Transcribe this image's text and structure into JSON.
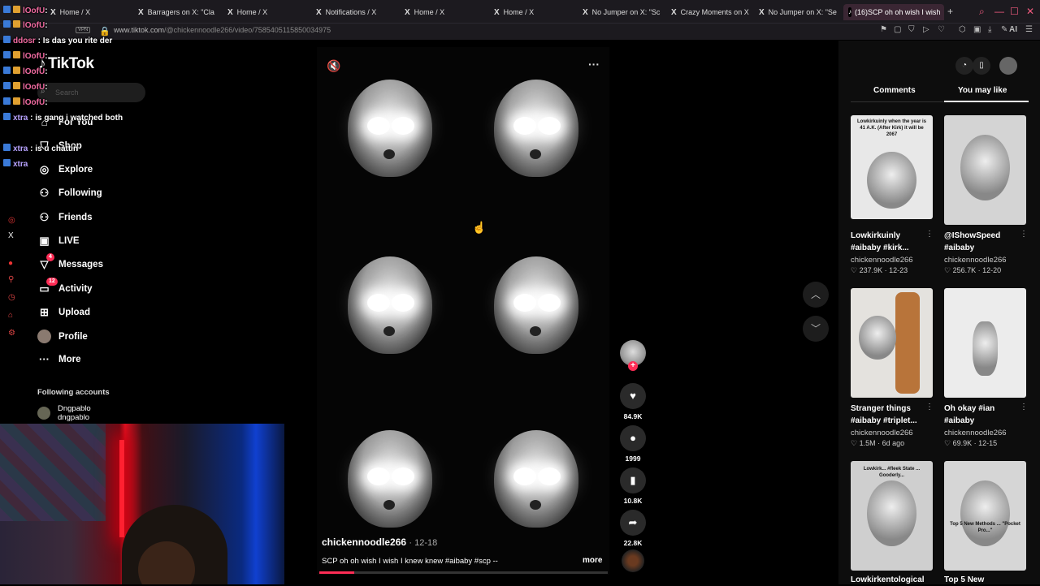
{
  "browser": {
    "tabs": [
      {
        "label": "Home / X"
      },
      {
        "label": "Barragers on X: \"Cla"
      },
      {
        "label": "Home / X"
      },
      {
        "label": "Notifications / X"
      },
      {
        "label": "Home / X"
      },
      {
        "label": "Home / X"
      },
      {
        "label": "No Jumper on X: \"Sc"
      },
      {
        "label": "Crazy Moments on X"
      },
      {
        "label": "No Jumper on X: \"Se"
      },
      {
        "label": "(16)SCP oh oh wish I wish"
      }
    ],
    "url_host": "www.tiktok.com",
    "url_path": "/@chickennoodle266/video/7585405115850034975",
    "vpn_label": "VPN",
    "ai_label": "AI"
  },
  "chat": [
    {
      "user": "lOofU",
      "msg": ""
    },
    {
      "user": "ddosr",
      "msg": "Is das you rite der"
    },
    {
      "user": "lOofU",
      "msg": ""
    },
    {
      "user": "lOofU",
      "msg": ""
    },
    {
      "user": "lOofU",
      "msg": ""
    },
    {
      "user": "lOofU",
      "msg": ""
    },
    {
      "user": "xtra",
      "msg": "is gang i watched both"
    },
    {
      "user": "lOofU",
      "msg": ""
    },
    {
      "user": "xtra",
      "msg": "is u chattin"
    },
    {
      "user": "xtra",
      "msg": ""
    }
  ],
  "chat_sep": ":",
  "sidebar": {
    "logo": "TikTok",
    "search_placeholder": "Search",
    "nav": [
      {
        "label": "For You"
      },
      {
        "label": "Shop"
      },
      {
        "label": "Explore"
      },
      {
        "label": "Following"
      },
      {
        "label": "Friends"
      },
      {
        "label": "LIVE"
      },
      {
        "label": "Messages",
        "badge": "4"
      },
      {
        "label": "Activity",
        "badge": "12"
      },
      {
        "label": "Upload"
      },
      {
        "label": "Profile"
      },
      {
        "label": "More"
      }
    ],
    "following_header": "Following accounts",
    "accounts": [
      {
        "name": "Dngpablo",
        "handle": "dngpablo"
      }
    ]
  },
  "video": {
    "creator": "chickennoodle266",
    "date": "12-18",
    "caption": "SCP oh oh wish I wish I knew knew #aibaby #scp --",
    "more": "more",
    "progress": 0.12,
    "likes": "84.9K",
    "comments": "1999",
    "saves": "10.8K",
    "shares": "22.8K",
    "plus": "+"
  },
  "right_panel": {
    "tabs": [
      {
        "label": "Comments"
      },
      {
        "label": "You may like"
      }
    ],
    "active_tab": "You may like",
    "cards": [
      {
        "title1": "Lowkirkuinly",
        "title2": "#aibaby #kirk...",
        "user": "chickennoodle266",
        "likes": "237.9K",
        "date": "12-23",
        "overlay": "Lowkirkuinly when the year is 41 A.K. (After Kirk) it will be 2067"
      },
      {
        "title1": "@IShowSpeed",
        "title2": "#aibaby",
        "user": "chickennoodle266",
        "likes": "256.7K",
        "date": "12-20",
        "overlay": ""
      },
      {
        "title1": "Stranger things",
        "title2": "#aibaby #triplet...",
        "user": "chickennoodle266",
        "likes": "1.5M",
        "date": "6d ago",
        "overlay": ""
      },
      {
        "title1": "Oh okay #ian",
        "title2": "#aibaby",
        "user": "chickennoodle266",
        "likes": "69.9K",
        "date": "12-15",
        "overlay": ""
      },
      {
        "title1": "Lowkirkentological",
        "title2": "",
        "user": "",
        "likes": "",
        "date": "",
        "overlay": "Lowkirk... #fleek State ... Gooderly..."
      },
      {
        "title1": "Top 5 New",
        "title2": "",
        "user": "",
        "likes": "",
        "date": "",
        "overlay": "Top 5 New Methods ... \"Pocket Pro...\""
      }
    ]
  }
}
